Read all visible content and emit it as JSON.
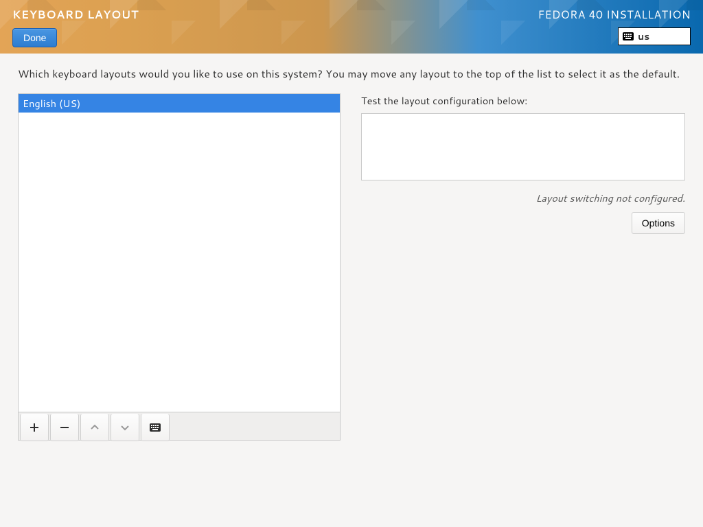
{
  "header": {
    "title": "KEYBOARD LAYOUT",
    "done_label": "Done",
    "install_title": "FEDORA 40 INSTALLATION",
    "keyboard_code": "us"
  },
  "main": {
    "prompt": "Which keyboard layouts would you like to use on this system?  You may move any layout to the top of the list to select it as the default.",
    "layouts": [
      {
        "name": "English (US)",
        "selected": true
      }
    ],
    "toolbar": {
      "add": "+",
      "remove": "−",
      "up": "enabled_false",
      "down": "enabled_false",
      "preview": "keyboard"
    },
    "test_label": "Test the layout configuration below:",
    "test_value": "",
    "switch_note": "Layout switching not configured.",
    "options_label": "Options"
  }
}
